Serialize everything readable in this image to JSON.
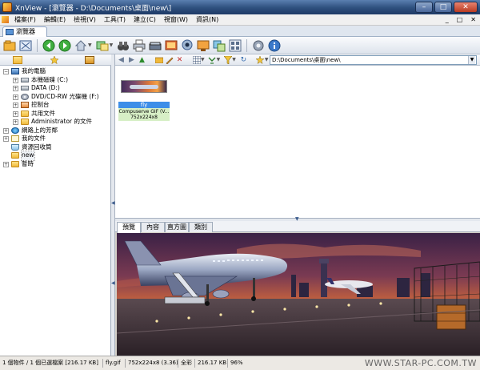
{
  "window": {
    "title": "XnView - [瀏覽器 - D:\\Documents\\桌面\\new\\]",
    "buttons": {
      "minimize": "–",
      "maximize": "□",
      "close": "✕"
    }
  },
  "menubar": {
    "items": [
      "檔案(F)",
      "編輯(E)",
      "檢視(V)",
      "工具(T)",
      "建立(C)",
      "視窗(W)",
      "資訊(N)"
    ],
    "mdi_buttons": [
      "_",
      "□",
      "✕"
    ]
  },
  "tab": {
    "label": "瀏覽器"
  },
  "toolbar": {
    "icons": [
      "open-icon",
      "fullscreen-icon",
      "back-icon",
      "forward-icon",
      "home-icon",
      "convert-icon",
      "binoculars-icon",
      "print-icon",
      "scanner-icon",
      "slideshow-icon",
      "webcam-icon",
      "screen-capture-icon",
      "multipage-icon",
      "settings-icon",
      "info-icon"
    ]
  },
  "left_panel": {
    "tabs": [
      "folders-tab-icon",
      "favorites-tab-icon",
      "categories-tab-icon"
    ],
    "tree": [
      {
        "label": "我的電腦",
        "icon": "pc",
        "level": 0,
        "expander": "−"
      },
      {
        "label": "本機磁碟 (C:)",
        "icon": "drive",
        "level": 1,
        "expander": "+"
      },
      {
        "label": "DATA (D:)",
        "icon": "drive",
        "level": 1,
        "expander": "+"
      },
      {
        "label": "DVD/CD-RW 光碟機 (F:)",
        "icon": "cd",
        "level": 1,
        "expander": "+"
      },
      {
        "label": "控制台",
        "icon": "cp",
        "level": 1,
        "expander": "+"
      },
      {
        "label": "共用文件",
        "icon": "folder",
        "level": 1,
        "expander": "+"
      },
      {
        "label": "Administrator 的文件",
        "icon": "folder",
        "level": 1,
        "expander": "+"
      },
      {
        "label": "網路上的芳鄰",
        "icon": "net",
        "level": 0,
        "expander": "+"
      },
      {
        "label": "我的文件",
        "icon": "doc",
        "level": 0,
        "expander": "+"
      },
      {
        "label": "資源回收筒",
        "icon": "bin",
        "level": 0,
        "expander": ""
      },
      {
        "label": "new",
        "icon": "folder",
        "level": 0,
        "expander": "",
        "selected": true
      },
      {
        "label": "暫時",
        "icon": "folder",
        "level": 0,
        "expander": "+"
      }
    ]
  },
  "address": {
    "value": "D:\\Documents\\桌面\\new\\"
  },
  "files": [
    {
      "name": "fly",
      "format": "Compuserve GIF (V...",
      "dims": "752x224x8"
    }
  ],
  "preview": {
    "tabs": [
      "預覽",
      "內容",
      "直方圖",
      "類別"
    ],
    "active_tab": 0
  },
  "statusbar": {
    "selection": "1 個物件 / 1 個已選檔案  [216.17 KB]",
    "filename": "fly.gif",
    "image_info": "752x224x8 (3.36)",
    "color": "全彩",
    "size": "216.17 KB",
    "zoom": "96%",
    "watermark": "WWW.STAR-PC.COM.TW"
  },
  "colors": {
    "title_bar": "#2e4f7d",
    "selection": "#3d8ee8",
    "thumb_info": "#d7efc6"
  }
}
